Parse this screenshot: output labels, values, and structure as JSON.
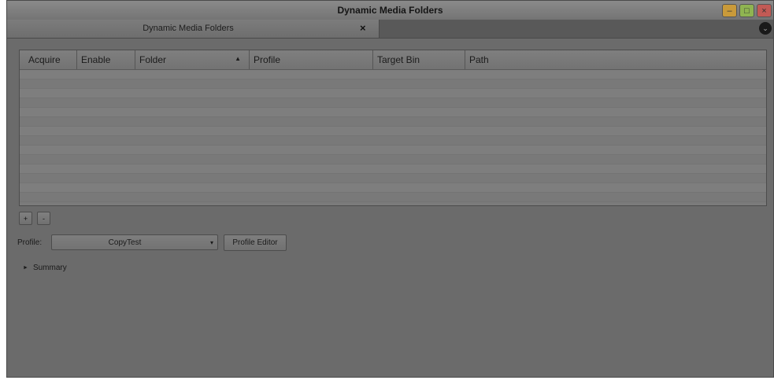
{
  "window": {
    "title": "Dynamic Media Folders",
    "buttons": {
      "minimize": "–",
      "maximize": "□",
      "close": "×"
    }
  },
  "tab": {
    "label": "Dynamic Media Folders",
    "close": "×",
    "menu": "⌄"
  },
  "table": {
    "columns": [
      "Acquire",
      "Enable",
      "Folder",
      "Profile",
      "Target Bin",
      "Path"
    ],
    "sorted_column": "Folder",
    "sort_indicator": "▲",
    "rows": []
  },
  "controls": {
    "add": "+",
    "remove": "-"
  },
  "profile": {
    "label": "Profile:",
    "value": "CopyTest",
    "dropdown_icon": "▾",
    "editor_button": "Profile Editor"
  },
  "summary": {
    "label": "Summary",
    "icon": "►"
  }
}
